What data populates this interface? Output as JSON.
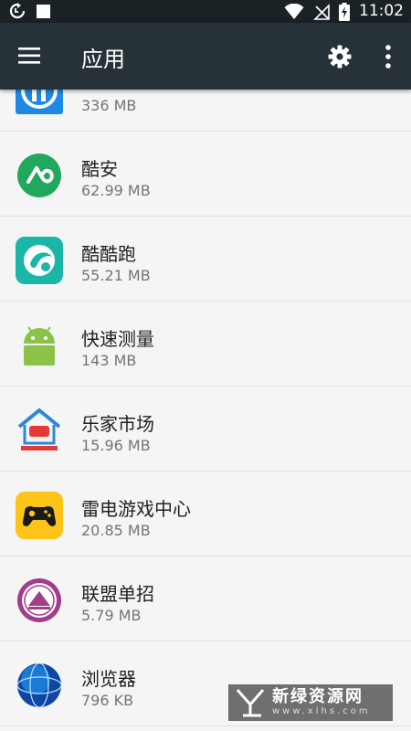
{
  "status_bar": {
    "time": "11:02"
  },
  "app_bar": {
    "title": "应用"
  },
  "apps": [
    {
      "name": "",
      "size": "336 MB",
      "icon": "app-icon-partial"
    },
    {
      "name": "酷安",
      "size": "62.99 MB",
      "icon": "coolapk-icon"
    },
    {
      "name": "酷酷跑",
      "size": "55.21 MB",
      "icon": "kukupao-icon"
    },
    {
      "name": "快速测量",
      "size": "143 MB",
      "icon": "android-icon"
    },
    {
      "name": "乐家市场",
      "size": "15.96 MB",
      "icon": "lejia-house-icon"
    },
    {
      "name": "雷电游戏中心",
      "size": "20.85 MB",
      "icon": "gamepad-icon"
    },
    {
      "name": "联盟单招",
      "size": "5.79 MB",
      "icon": "emblem-icon"
    },
    {
      "name": "浏览器",
      "size": "796 KB",
      "icon": "globe-icon"
    }
  ],
  "watermark": {
    "title": "新绿资源网",
    "url": "www.xlhs.com"
  }
}
